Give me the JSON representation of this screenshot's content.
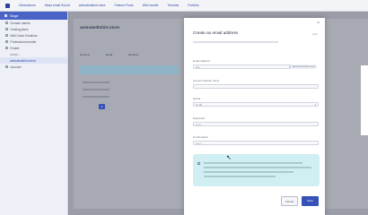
{
  "topbar": {
    "links": [
      "Generateurs",
      "Mass email Sound",
      "animatedtshirt.store",
      "Feature Posts",
      "Web emails",
      "Tutorials",
      "Portfolio"
    ]
  },
  "sidebar": {
    "header": "Stage",
    "items": [
      {
        "label": "Domain names",
        "type": "item"
      },
      {
        "label": "Hosting plans",
        "type": "item"
      },
      {
        "label": "Mail Cloud Solutions",
        "type": "item"
      },
      {
        "label": "Professional emails",
        "type": "item"
      },
      {
        "label": "Emails",
        "type": "item"
      },
      {
        "label": "anodo...",
        "type": "sub"
      },
      {
        "label": "animatedtshirt.store",
        "type": "active"
      },
      {
        "label": "Account",
        "type": "item"
      }
    ]
  },
  "main": {
    "title": "animatedtshirt.store",
    "tabs": [
      "General",
      "Email",
      "Redirect"
    ],
    "page_number": "1"
  },
  "modal": {
    "title": "Create an email address",
    "help": "Help",
    "close": "×",
    "fields": {
      "email_label": "Email address",
      "email_value": "info",
      "domain_value": "@animatedtshirt.store",
      "name_label": "Account display name",
      "quota_label": "Quota",
      "quota_value": "5 GB",
      "password_label": "Password",
      "password_value": "••••••",
      "confirm_label": "Confirmation",
      "confirm_value": "••••••"
    },
    "cancel_label": "Cancel",
    "save_label": "Save"
  }
}
